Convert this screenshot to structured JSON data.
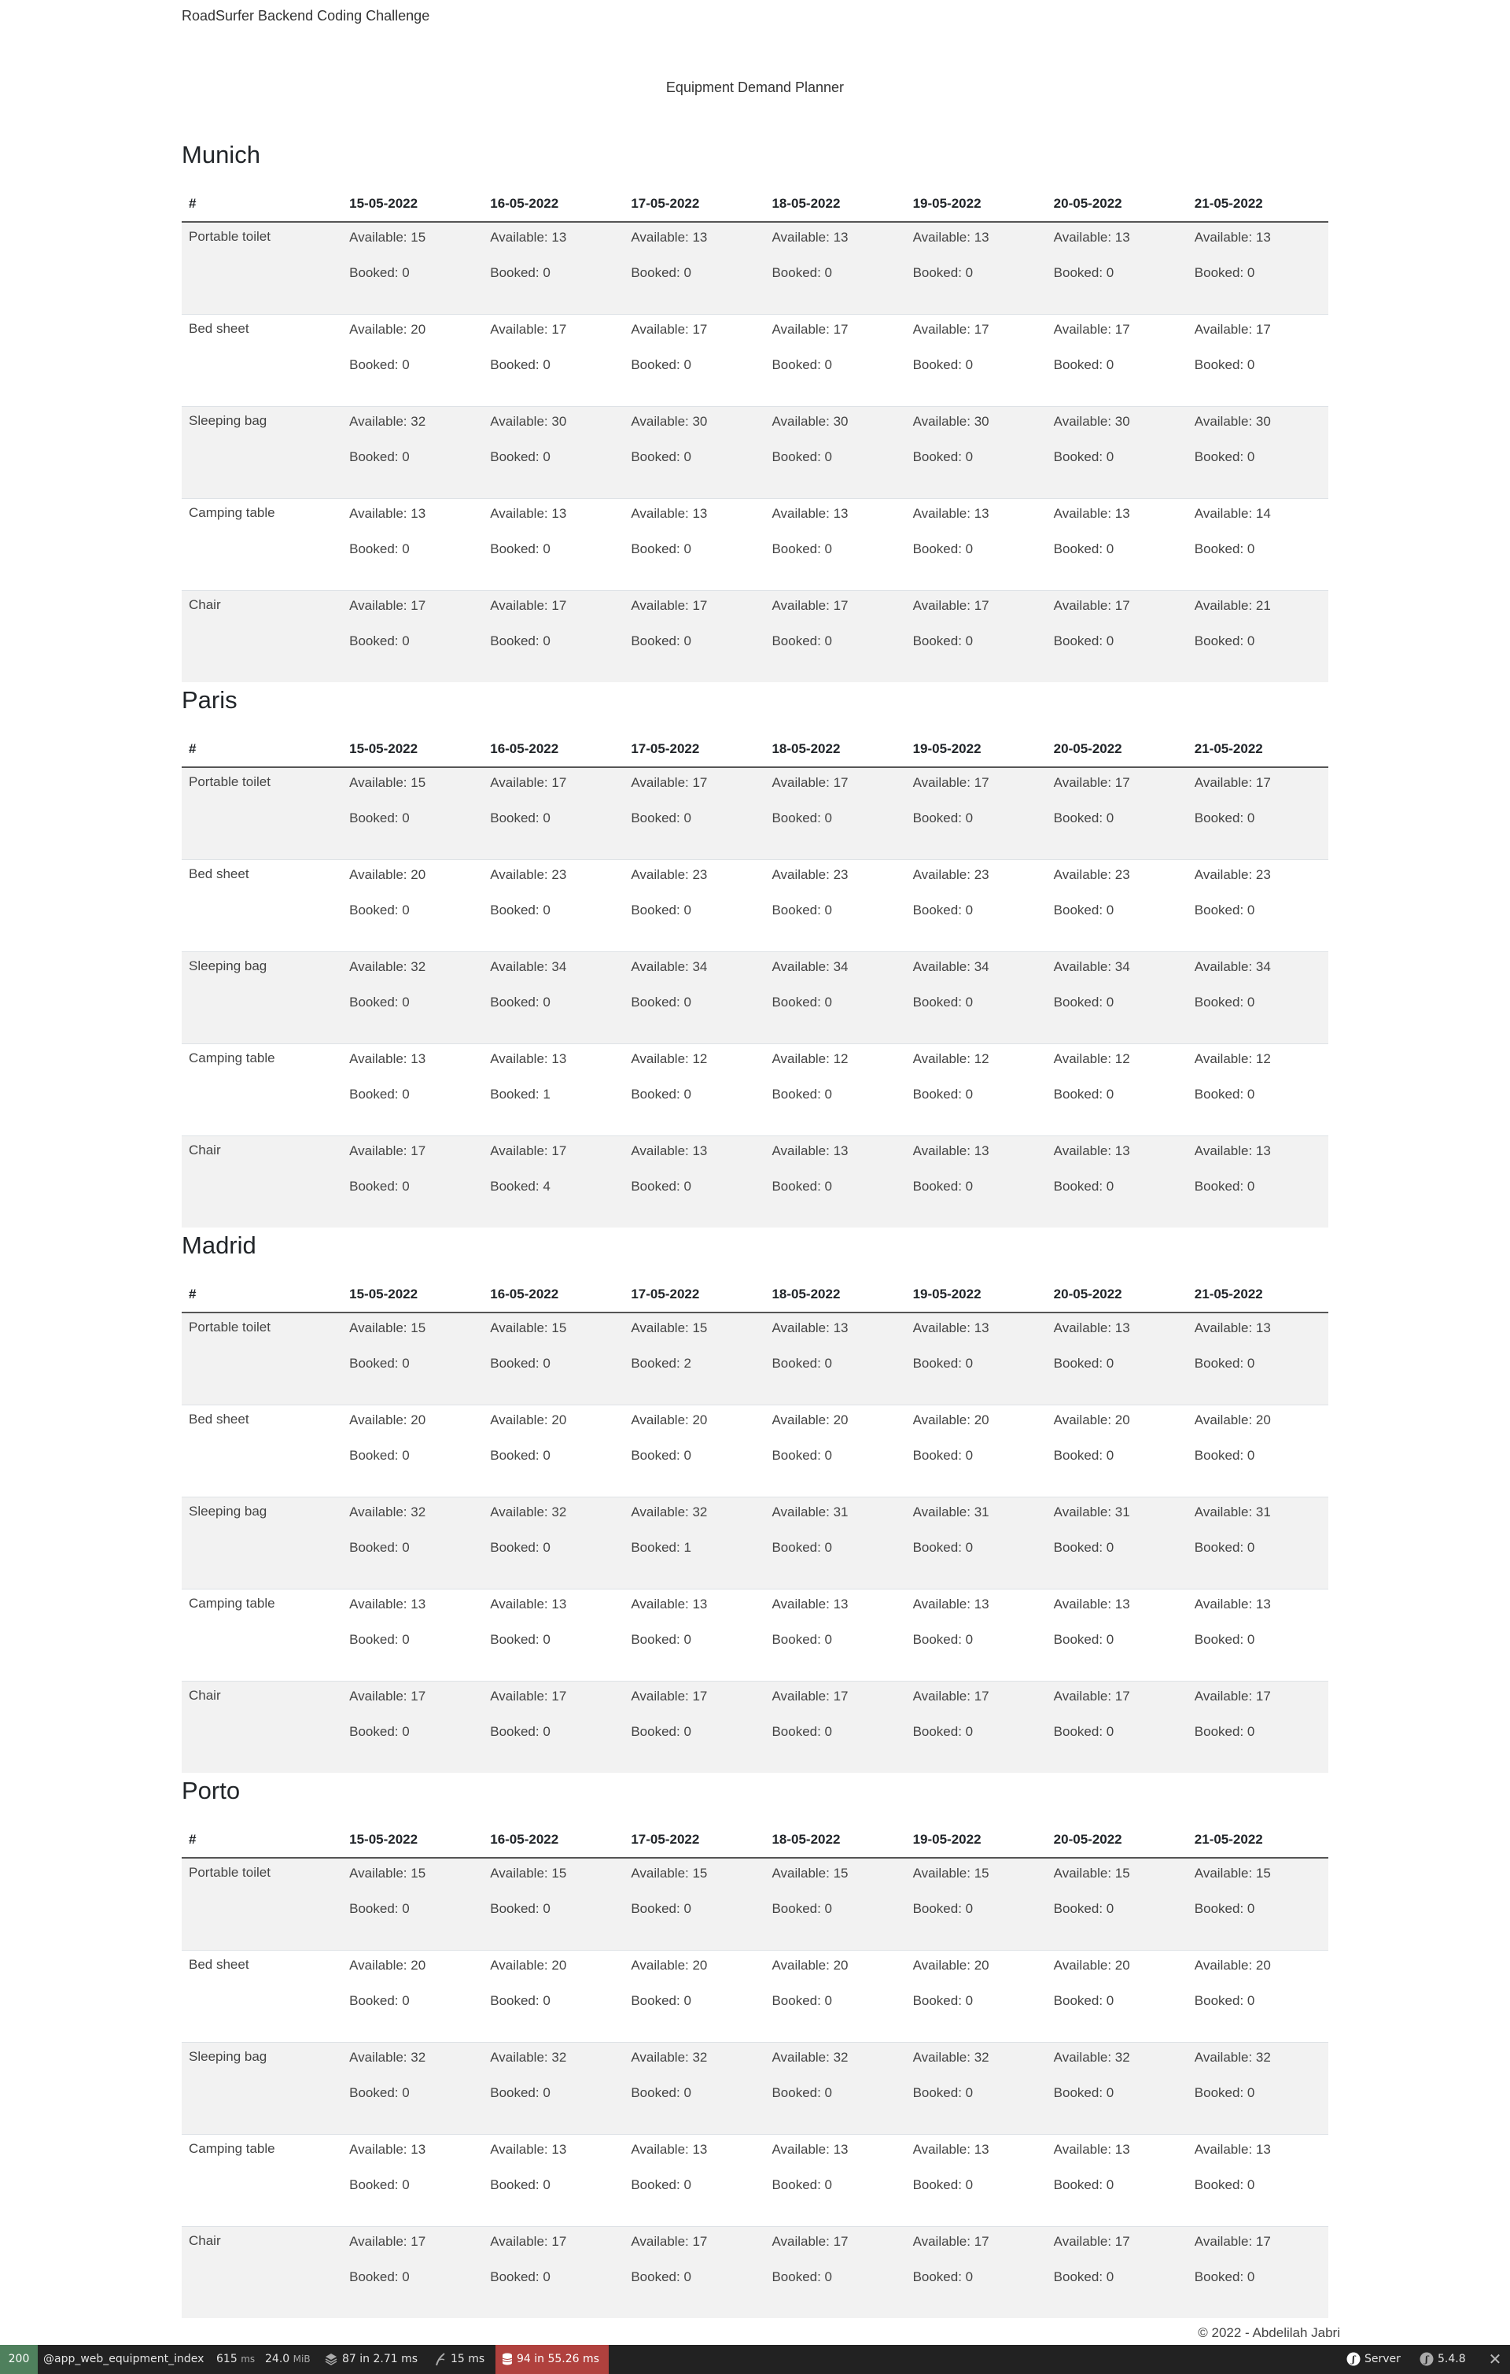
{
  "header": {
    "brand": "RoadSurfer Backend Coding Challenge",
    "subtitle": "Equipment Demand Planner"
  },
  "table_header": {
    "first_col": "#",
    "dates": [
      "15-05-2022",
      "16-05-2022",
      "17-05-2022",
      "18-05-2022",
      "19-05-2022",
      "20-05-2022",
      "21-05-2022"
    ]
  },
  "cities": [
    {
      "name": "Munich",
      "rows": [
        {
          "item": "Portable toilet",
          "cells": [
            {
              "available": "Available: 15",
              "booked": "Booked: 0"
            },
            {
              "available": "Available: 13",
              "booked": "Booked: 0"
            },
            {
              "available": "Available: 13",
              "booked": "Booked: 0"
            },
            {
              "available": "Available: 13",
              "booked": "Booked: 0"
            },
            {
              "available": "Available: 13",
              "booked": "Booked: 0"
            },
            {
              "available": "Available: 13",
              "booked": "Booked: 0"
            },
            {
              "available": "Available: 13",
              "booked": "Booked: 0"
            }
          ]
        },
        {
          "item": "Bed sheet",
          "cells": [
            {
              "available": "Available: 20",
              "booked": "Booked: 0"
            },
            {
              "available": "Available: 17",
              "booked": "Booked: 0"
            },
            {
              "available": "Available: 17",
              "booked": "Booked: 0"
            },
            {
              "available": "Available: 17",
              "booked": "Booked: 0"
            },
            {
              "available": "Available: 17",
              "booked": "Booked: 0"
            },
            {
              "available": "Available: 17",
              "booked": "Booked: 0"
            },
            {
              "available": "Available: 17",
              "booked": "Booked: 0"
            }
          ]
        },
        {
          "item": "Sleeping bag",
          "cells": [
            {
              "available": "Available: 32",
              "booked": "Booked: 0"
            },
            {
              "available": "Available: 30",
              "booked": "Booked: 0"
            },
            {
              "available": "Available: 30",
              "booked": "Booked: 0"
            },
            {
              "available": "Available: 30",
              "booked": "Booked: 0"
            },
            {
              "available": "Available: 30",
              "booked": "Booked: 0"
            },
            {
              "available": "Available: 30",
              "booked": "Booked: 0"
            },
            {
              "available": "Available: 30",
              "booked": "Booked: 0"
            }
          ]
        },
        {
          "item": "Camping table",
          "cells": [
            {
              "available": "Available: 13",
              "booked": "Booked: 0"
            },
            {
              "available": "Available: 13",
              "booked": "Booked: 0"
            },
            {
              "available": "Available: 13",
              "booked": "Booked: 0"
            },
            {
              "available": "Available: 13",
              "booked": "Booked: 0"
            },
            {
              "available": "Available: 13",
              "booked": "Booked: 0"
            },
            {
              "available": "Available: 13",
              "booked": "Booked: 0"
            },
            {
              "available": "Available: 14",
              "booked": "Booked: 0"
            }
          ]
        },
        {
          "item": "Chair",
          "cells": [
            {
              "available": "Available: 17",
              "booked": "Booked: 0"
            },
            {
              "available": "Available: 17",
              "booked": "Booked: 0"
            },
            {
              "available": "Available: 17",
              "booked": "Booked: 0"
            },
            {
              "available": "Available: 17",
              "booked": "Booked: 0"
            },
            {
              "available": "Available: 17",
              "booked": "Booked: 0"
            },
            {
              "available": "Available: 17",
              "booked": "Booked: 0"
            },
            {
              "available": "Available: 21",
              "booked": "Booked: 0"
            }
          ]
        }
      ]
    },
    {
      "name": "Paris",
      "rows": [
        {
          "item": "Portable toilet",
          "cells": [
            {
              "available": "Available: 15",
              "booked": "Booked: 0"
            },
            {
              "available": "Available: 17",
              "booked": "Booked: 0"
            },
            {
              "available": "Available: 17",
              "booked": "Booked: 0"
            },
            {
              "available": "Available: 17",
              "booked": "Booked: 0"
            },
            {
              "available": "Available: 17",
              "booked": "Booked: 0"
            },
            {
              "available": "Available: 17",
              "booked": "Booked: 0"
            },
            {
              "available": "Available: 17",
              "booked": "Booked: 0"
            }
          ]
        },
        {
          "item": "Bed sheet",
          "cells": [
            {
              "available": "Available: 20",
              "booked": "Booked: 0"
            },
            {
              "available": "Available: 23",
              "booked": "Booked: 0"
            },
            {
              "available": "Available: 23",
              "booked": "Booked: 0"
            },
            {
              "available": "Available: 23",
              "booked": "Booked: 0"
            },
            {
              "available": "Available: 23",
              "booked": "Booked: 0"
            },
            {
              "available": "Available: 23",
              "booked": "Booked: 0"
            },
            {
              "available": "Available: 23",
              "booked": "Booked: 0"
            }
          ]
        },
        {
          "item": "Sleeping bag",
          "cells": [
            {
              "available": "Available: 32",
              "booked": "Booked: 0"
            },
            {
              "available": "Available: 34",
              "booked": "Booked: 0"
            },
            {
              "available": "Available: 34",
              "booked": "Booked: 0"
            },
            {
              "available": "Available: 34",
              "booked": "Booked: 0"
            },
            {
              "available": "Available: 34",
              "booked": "Booked: 0"
            },
            {
              "available": "Available: 34",
              "booked": "Booked: 0"
            },
            {
              "available": "Available: 34",
              "booked": "Booked: 0"
            }
          ]
        },
        {
          "item": "Camping table",
          "cells": [
            {
              "available": "Available: 13",
              "booked": "Booked: 0"
            },
            {
              "available": "Available: 13",
              "booked": "Booked: 1"
            },
            {
              "available": "Available: 12",
              "booked": "Booked: 0"
            },
            {
              "available": "Available: 12",
              "booked": "Booked: 0"
            },
            {
              "available": "Available: 12",
              "booked": "Booked: 0"
            },
            {
              "available": "Available: 12",
              "booked": "Booked: 0"
            },
            {
              "available": "Available: 12",
              "booked": "Booked: 0"
            }
          ]
        },
        {
          "item": "Chair",
          "cells": [
            {
              "available": "Available: 17",
              "booked": "Booked: 0"
            },
            {
              "available": "Available: 17",
              "booked": "Booked: 4"
            },
            {
              "available": "Available: 13",
              "booked": "Booked: 0"
            },
            {
              "available": "Available: 13",
              "booked": "Booked: 0"
            },
            {
              "available": "Available: 13",
              "booked": "Booked: 0"
            },
            {
              "available": "Available: 13",
              "booked": "Booked: 0"
            },
            {
              "available": "Available: 13",
              "booked": "Booked: 0"
            }
          ]
        }
      ]
    },
    {
      "name": "Madrid",
      "rows": [
        {
          "item": "Portable toilet",
          "cells": [
            {
              "available": "Available: 15",
              "booked": "Booked: 0"
            },
            {
              "available": "Available: 15",
              "booked": "Booked: 0"
            },
            {
              "available": "Available: 15",
              "booked": "Booked: 2"
            },
            {
              "available": "Available: 13",
              "booked": "Booked: 0"
            },
            {
              "available": "Available: 13",
              "booked": "Booked: 0"
            },
            {
              "available": "Available: 13",
              "booked": "Booked: 0"
            },
            {
              "available": "Available: 13",
              "booked": "Booked: 0"
            }
          ]
        },
        {
          "item": "Bed sheet",
          "cells": [
            {
              "available": "Available: 20",
              "booked": "Booked: 0"
            },
            {
              "available": "Available: 20",
              "booked": "Booked: 0"
            },
            {
              "available": "Available: 20",
              "booked": "Booked: 0"
            },
            {
              "available": "Available: 20",
              "booked": "Booked: 0"
            },
            {
              "available": "Available: 20",
              "booked": "Booked: 0"
            },
            {
              "available": "Available: 20",
              "booked": "Booked: 0"
            },
            {
              "available": "Available: 20",
              "booked": "Booked: 0"
            }
          ]
        },
        {
          "item": "Sleeping bag",
          "cells": [
            {
              "available": "Available: 32",
              "booked": "Booked: 0"
            },
            {
              "available": "Available: 32",
              "booked": "Booked: 0"
            },
            {
              "available": "Available: 32",
              "booked": "Booked: 1"
            },
            {
              "available": "Available: 31",
              "booked": "Booked: 0"
            },
            {
              "available": "Available: 31",
              "booked": "Booked: 0"
            },
            {
              "available": "Available: 31",
              "booked": "Booked: 0"
            },
            {
              "available": "Available: 31",
              "booked": "Booked: 0"
            }
          ]
        },
        {
          "item": "Camping table",
          "cells": [
            {
              "available": "Available: 13",
              "booked": "Booked: 0"
            },
            {
              "available": "Available: 13",
              "booked": "Booked: 0"
            },
            {
              "available": "Available: 13",
              "booked": "Booked: 0"
            },
            {
              "available": "Available: 13",
              "booked": "Booked: 0"
            },
            {
              "available": "Available: 13",
              "booked": "Booked: 0"
            },
            {
              "available": "Available: 13",
              "booked": "Booked: 0"
            },
            {
              "available": "Available: 13",
              "booked": "Booked: 0"
            }
          ]
        },
        {
          "item": "Chair",
          "cells": [
            {
              "available": "Available: 17",
              "booked": "Booked: 0"
            },
            {
              "available": "Available: 17",
              "booked": "Booked: 0"
            },
            {
              "available": "Available: 17",
              "booked": "Booked: 0"
            },
            {
              "available": "Available: 17",
              "booked": "Booked: 0"
            },
            {
              "available": "Available: 17",
              "booked": "Booked: 0"
            },
            {
              "available": "Available: 17",
              "booked": "Booked: 0"
            },
            {
              "available": "Available: 17",
              "booked": "Booked: 0"
            }
          ]
        }
      ]
    },
    {
      "name": "Porto",
      "rows": [
        {
          "item": "Portable toilet",
          "cells": [
            {
              "available": "Available: 15",
              "booked": "Booked: 0"
            },
            {
              "available": "Available: 15",
              "booked": "Booked: 0"
            },
            {
              "available": "Available: 15",
              "booked": "Booked: 0"
            },
            {
              "available": "Available: 15",
              "booked": "Booked: 0"
            },
            {
              "available": "Available: 15",
              "booked": "Booked: 0"
            },
            {
              "available": "Available: 15",
              "booked": "Booked: 0"
            },
            {
              "available": "Available: 15",
              "booked": "Booked: 0"
            }
          ]
        },
        {
          "item": "Bed sheet",
          "cells": [
            {
              "available": "Available: 20",
              "booked": "Booked: 0"
            },
            {
              "available": "Available: 20",
              "booked": "Booked: 0"
            },
            {
              "available": "Available: 20",
              "booked": "Booked: 0"
            },
            {
              "available": "Available: 20",
              "booked": "Booked: 0"
            },
            {
              "available": "Available: 20",
              "booked": "Booked: 0"
            },
            {
              "available": "Available: 20",
              "booked": "Booked: 0"
            },
            {
              "available": "Available: 20",
              "booked": "Booked: 0"
            }
          ]
        },
        {
          "item": "Sleeping bag",
          "cells": [
            {
              "available": "Available: 32",
              "booked": "Booked: 0"
            },
            {
              "available": "Available: 32",
              "booked": "Booked: 0"
            },
            {
              "available": "Available: 32",
              "booked": "Booked: 0"
            },
            {
              "available": "Available: 32",
              "booked": "Booked: 0"
            },
            {
              "available": "Available: 32",
              "booked": "Booked: 0"
            },
            {
              "available": "Available: 32",
              "booked": "Booked: 0"
            },
            {
              "available": "Available: 32",
              "booked": "Booked: 0"
            }
          ]
        },
        {
          "item": "Camping table",
          "cells": [
            {
              "available": "Available: 13",
              "booked": "Booked: 0"
            },
            {
              "available": "Available: 13",
              "booked": "Booked: 0"
            },
            {
              "available": "Available: 13",
              "booked": "Booked: 0"
            },
            {
              "available": "Available: 13",
              "booked": "Booked: 0"
            },
            {
              "available": "Available: 13",
              "booked": "Booked: 0"
            },
            {
              "available": "Available: 13",
              "booked": "Booked: 0"
            },
            {
              "available": "Available: 13",
              "booked": "Booked: 0"
            }
          ]
        },
        {
          "item": "Chair",
          "cells": [
            {
              "available": "Available: 17",
              "booked": "Booked: 0"
            },
            {
              "available": "Available: 17",
              "booked": "Booked: 0"
            },
            {
              "available": "Available: 17",
              "booked": "Booked: 0"
            },
            {
              "available": "Available: 17",
              "booked": "Booked: 0"
            },
            {
              "available": "Available: 17",
              "booked": "Booked: 0"
            },
            {
              "available": "Available: 17",
              "booked": "Booked: 0"
            },
            {
              "available": "Available: 17",
              "booked": "Booked: 0"
            }
          ]
        }
      ]
    }
  ],
  "footer": {
    "text": "© 2022 - Abdelilah Jabri"
  },
  "debug_toolbar": {
    "status_code": "200",
    "route": "@app_web_equipment_index",
    "time_value": "615",
    "time_unit": "ms",
    "memory_value": "24.0",
    "memory_unit": "MiB",
    "db_text": "87 in 2.71 ms",
    "twig_text": "15 ms",
    "warning_text": "94 in 55.26 ms",
    "server_label": "Server",
    "version": "5.4.8",
    "close_glyph": "✕",
    "icons": [
      "layers-icon",
      "twig-icon",
      "database-icon",
      "symfony-icon",
      "close-icon"
    ],
    "colors": {
      "status_bg": "#4f805d",
      "warning_bg": "#b0413e",
      "bar_bg": "#222222"
    }
  }
}
